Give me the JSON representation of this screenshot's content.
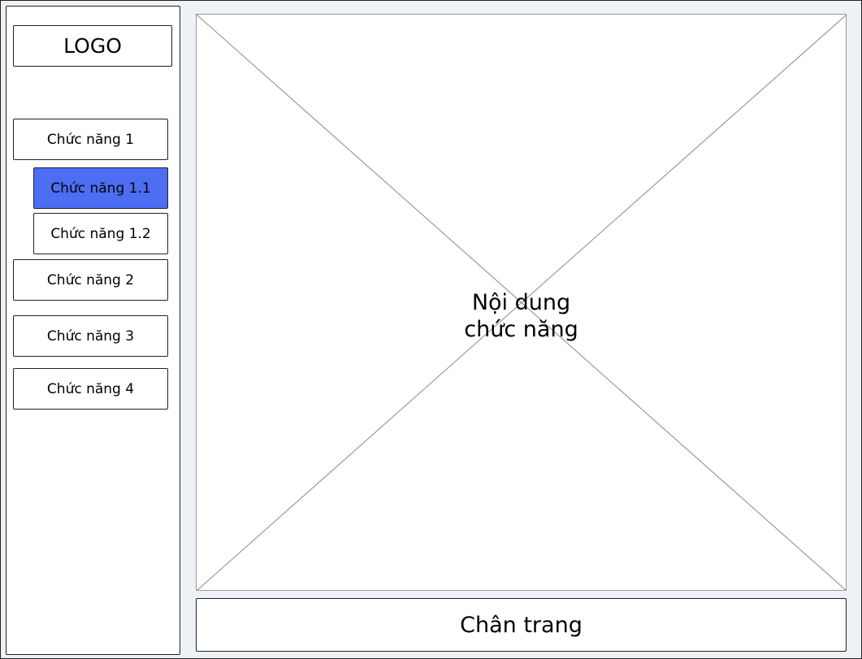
{
  "sidebar": {
    "logo": "LOGO",
    "items": [
      {
        "label": "Chức năng 1"
      },
      {
        "label": "Chức năng 1.1"
      },
      {
        "label": "Chức năng 1.2"
      },
      {
        "label": "Chức năng 2"
      },
      {
        "label": "Chức năng 3"
      },
      {
        "label": "Chức năng 4"
      }
    ],
    "active_index": 1
  },
  "main": {
    "placeholder_line1": "Nội dung",
    "placeholder_line2": "chức năng"
  },
  "footer": {
    "label": "Chân trang"
  },
  "colors": {
    "background": "#eef2f7",
    "active_item": "#4d6ef2",
    "border": "#222222"
  }
}
